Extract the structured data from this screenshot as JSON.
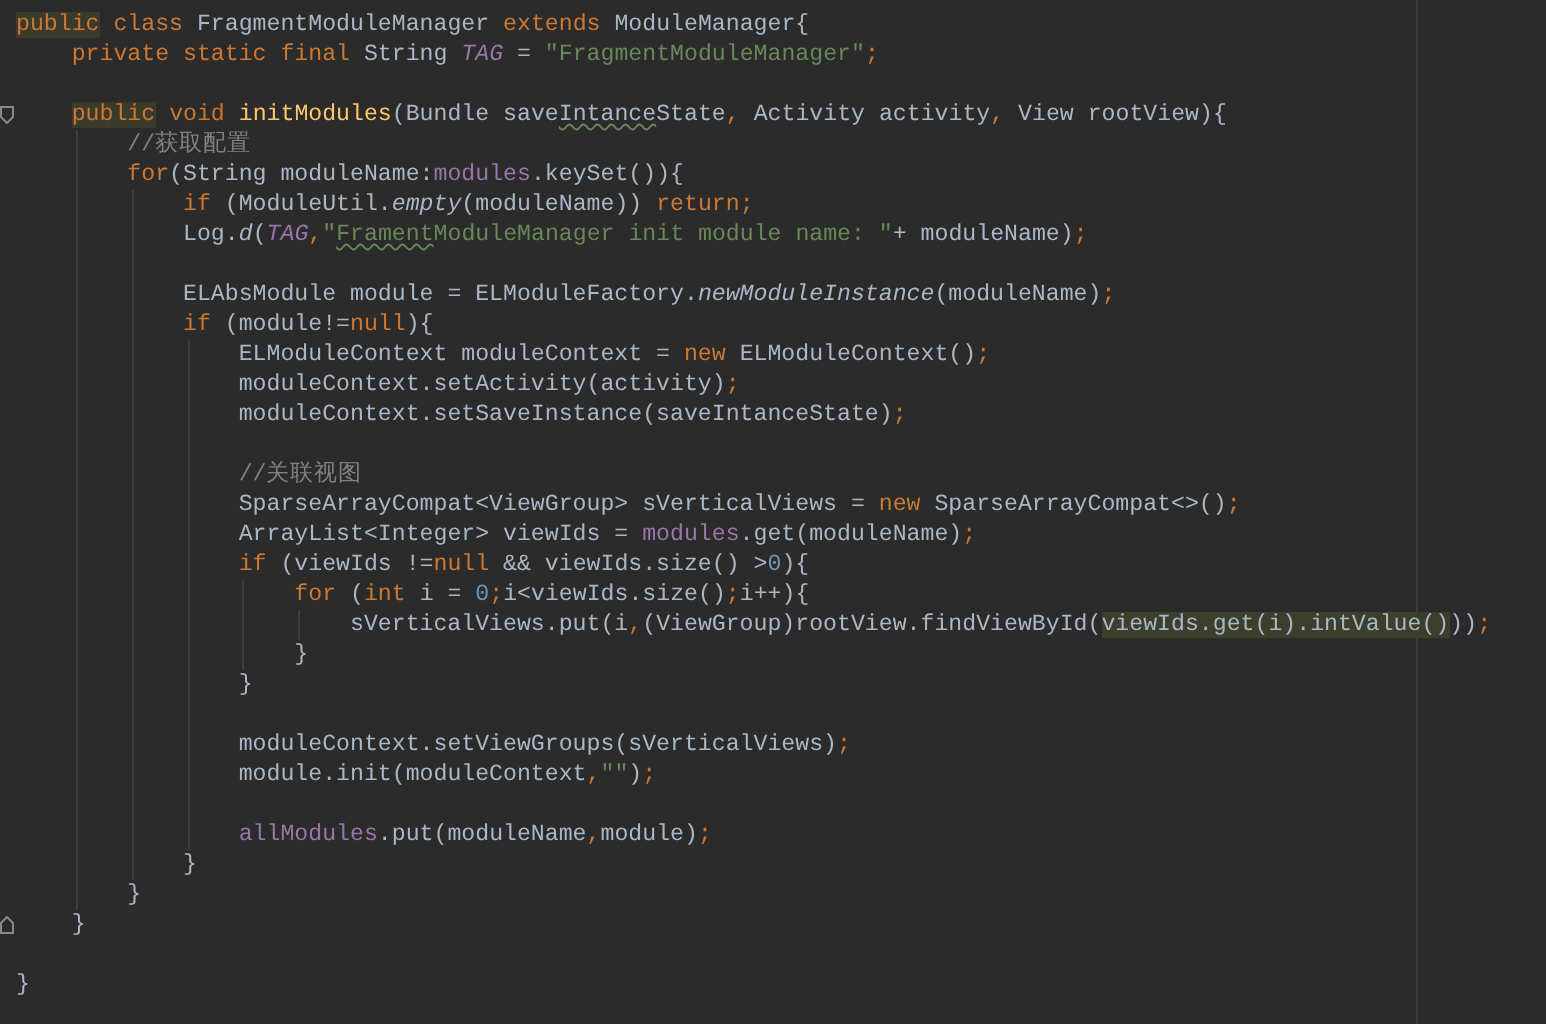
{
  "editor": {
    "lines": [
      {
        "kind": "code",
        "tokens": [
          {
            "text": "public",
            "kind": "kwmark"
          },
          {
            "text": " class ",
            "kind": "kw"
          },
          {
            "text": "FragmentModuleManager ",
            "kind": "plain"
          },
          {
            "text": "extends ",
            "kind": "kw"
          },
          {
            "text": "ModuleManager{",
            "kind": "plain"
          }
        ]
      },
      {
        "kind": "code",
        "tokens": [
          {
            "text": "    private static final ",
            "kind": "kw"
          },
          {
            "text": "String ",
            "kind": "plain"
          },
          {
            "text": "TAG",
            "kind": "const"
          },
          {
            "text": " = ",
            "kind": "plain"
          },
          {
            "text": "\"FragmentModuleManager\"",
            "kind": "str"
          },
          {
            "text": ";",
            "kind": "kw"
          }
        ]
      },
      {
        "kind": "blank"
      },
      {
        "kind": "code",
        "fold_start": true,
        "tokens": [
          {
            "text": "    public",
            "kind": "kwmark"
          },
          {
            "text": " void ",
            "kind": "kw"
          },
          {
            "text": "initModules",
            "kind": "decl"
          },
          {
            "text": "(Bundle save",
            "kind": "plain"
          },
          {
            "text": "Intance",
            "kind": "typo"
          },
          {
            "text": "State",
            "kind": "plain"
          },
          {
            "text": ",",
            "kind": "kw"
          },
          {
            "text": " Activity activity",
            "kind": "plain"
          },
          {
            "text": ",",
            "kind": "kw"
          },
          {
            "text": " View rootView){",
            "kind": "plain"
          }
        ]
      },
      {
        "kind": "code",
        "tokens": [
          {
            "text": "        //获取配置",
            "kind": "comment"
          }
        ]
      },
      {
        "kind": "code",
        "tokens": [
          {
            "text": "        for",
            "kind": "kw"
          },
          {
            "text": "(String moduleName:",
            "kind": "plain"
          },
          {
            "text": "modules",
            "kind": "field"
          },
          {
            "text": ".keySet()){",
            "kind": "plain"
          }
        ]
      },
      {
        "kind": "code",
        "tokens": [
          {
            "text": "            if ",
            "kind": "kw"
          },
          {
            "text": "(ModuleUtil.",
            "kind": "plain"
          },
          {
            "text": "empty",
            "kind": "italic"
          },
          {
            "text": "(moduleName)) ",
            "kind": "plain"
          },
          {
            "text": "return;",
            "kind": "kw"
          }
        ]
      },
      {
        "kind": "code",
        "tokens": [
          {
            "text": "            Log.",
            "kind": "plain"
          },
          {
            "text": "d",
            "kind": "italic"
          },
          {
            "text": "(",
            "kind": "plain"
          },
          {
            "text": "TAG",
            "kind": "const"
          },
          {
            "text": ",",
            "kind": "kw"
          },
          {
            "text": "\"",
            "kind": "str"
          },
          {
            "text": "Frament",
            "kind": "strtypo"
          },
          {
            "text": "ModuleManager init module name: \"",
            "kind": "str"
          },
          {
            "text": "+ moduleName)",
            "kind": "plain"
          },
          {
            "text": ";",
            "kind": "kw"
          }
        ]
      },
      {
        "kind": "blank"
      },
      {
        "kind": "code",
        "tokens": [
          {
            "text": "            ELAbsModule module = ELModuleFactory.",
            "kind": "plain"
          },
          {
            "text": "newModuleInstance",
            "kind": "italic"
          },
          {
            "text": "(moduleName)",
            "kind": "plain"
          },
          {
            "text": ";",
            "kind": "kw"
          }
        ]
      },
      {
        "kind": "code",
        "tokens": [
          {
            "text": "            if ",
            "kind": "kw"
          },
          {
            "text": "(module!=",
            "kind": "plain"
          },
          {
            "text": "null",
            "kind": "kw"
          },
          {
            "text": "){",
            "kind": "plain"
          }
        ]
      },
      {
        "kind": "code",
        "tokens": [
          {
            "text": "                ELModuleContext moduleContext = ",
            "kind": "plain"
          },
          {
            "text": "new ",
            "kind": "kw"
          },
          {
            "text": "ELModuleContext()",
            "kind": "plain"
          },
          {
            "text": ";",
            "kind": "kw"
          }
        ]
      },
      {
        "kind": "code",
        "tokens": [
          {
            "text": "                moduleContext.setActivity(activity)",
            "kind": "plain"
          },
          {
            "text": ";",
            "kind": "kw"
          }
        ]
      },
      {
        "kind": "code",
        "tokens": [
          {
            "text": "                moduleContext.setSaveInstance(saveIntanceState)",
            "kind": "plain"
          },
          {
            "text": ";",
            "kind": "kw"
          }
        ]
      },
      {
        "kind": "blank"
      },
      {
        "kind": "code",
        "tokens": [
          {
            "text": "                //关联视图",
            "kind": "comment"
          }
        ]
      },
      {
        "kind": "code",
        "tokens": [
          {
            "text": "                SparseArrayCompat<ViewGroup> sVerticalViews = ",
            "kind": "plain"
          },
          {
            "text": "new ",
            "kind": "kw"
          },
          {
            "text": "SparseArrayCompat<>()",
            "kind": "plain"
          },
          {
            "text": ";",
            "kind": "kw"
          }
        ]
      },
      {
        "kind": "code",
        "tokens": [
          {
            "text": "                ArrayList<Integer> viewIds = ",
            "kind": "plain"
          },
          {
            "text": "modules",
            "kind": "field"
          },
          {
            "text": ".get(moduleName)",
            "kind": "plain"
          },
          {
            "text": ";",
            "kind": "kw"
          }
        ]
      },
      {
        "kind": "code",
        "tokens": [
          {
            "text": "                if ",
            "kind": "kw"
          },
          {
            "text": "(viewIds !=",
            "kind": "plain"
          },
          {
            "text": "null ",
            "kind": "kw"
          },
          {
            "text": "&& viewIds.size() >",
            "kind": "plain"
          },
          {
            "text": "0",
            "kind": "num"
          },
          {
            "text": "){",
            "kind": "plain"
          }
        ]
      },
      {
        "kind": "code",
        "tokens": [
          {
            "text": "                    for ",
            "kind": "kw"
          },
          {
            "text": "(",
            "kind": "plain"
          },
          {
            "text": "int ",
            "kind": "kw"
          },
          {
            "text": "i = ",
            "kind": "plain"
          },
          {
            "text": "0",
            "kind": "num"
          },
          {
            "text": ";",
            "kind": "kw"
          },
          {
            "text": "i<viewIds.size()",
            "kind": "plain"
          },
          {
            "text": ";",
            "kind": "kw"
          },
          {
            "text": "i++){",
            "kind": "plain"
          }
        ]
      },
      {
        "kind": "code",
        "tokens": [
          {
            "text": "                        sVerticalViews.put(i",
            "kind": "plain"
          },
          {
            "text": ",",
            "kind": "kw"
          },
          {
            "text": "(ViewGroup)rootView.findViewById(",
            "kind": "plain"
          },
          {
            "text": "viewIds.get(i).intValue()",
            "kind": "hl"
          },
          {
            "text": "))",
            "kind": "plain"
          },
          {
            "text": ";",
            "kind": "kw"
          }
        ]
      },
      {
        "kind": "code",
        "tokens": [
          {
            "text": "                    }",
            "kind": "plain"
          }
        ]
      },
      {
        "kind": "code",
        "tokens": [
          {
            "text": "                }",
            "kind": "plain"
          }
        ]
      },
      {
        "kind": "blank"
      },
      {
        "kind": "code",
        "tokens": [
          {
            "text": "                moduleContext.setViewGroups(sVerticalViews)",
            "kind": "plain"
          },
          {
            "text": ";",
            "kind": "kw"
          }
        ]
      },
      {
        "kind": "code",
        "tokens": [
          {
            "text": "                module.init(moduleContext",
            "kind": "plain"
          },
          {
            "text": ",",
            "kind": "kw"
          },
          {
            "text": "\"\"",
            "kind": "str"
          },
          {
            "text": ")",
            "kind": "plain"
          },
          {
            "text": ";",
            "kind": "kw"
          }
        ]
      },
      {
        "kind": "blank"
      },
      {
        "kind": "code",
        "tokens": [
          {
            "text": "                allModules",
            "kind": "field"
          },
          {
            "text": ".put(moduleName",
            "kind": "plain"
          },
          {
            "text": ",",
            "kind": "kw"
          },
          {
            "text": "module)",
            "kind": "plain"
          },
          {
            "text": ";",
            "kind": "kw"
          }
        ]
      },
      {
        "kind": "code",
        "tokens": [
          {
            "text": "            }",
            "kind": "plain"
          }
        ]
      },
      {
        "kind": "code",
        "tokens": [
          {
            "text": "        }",
            "kind": "plain"
          }
        ]
      },
      {
        "kind": "code",
        "fold_end": true,
        "tokens": [
          {
            "text": "    }",
            "kind": "plain"
          }
        ]
      },
      {
        "kind": "blank"
      },
      {
        "kind": "code",
        "tokens": [
          {
            "text": "}",
            "kind": "plain"
          }
        ]
      }
    ]
  }
}
